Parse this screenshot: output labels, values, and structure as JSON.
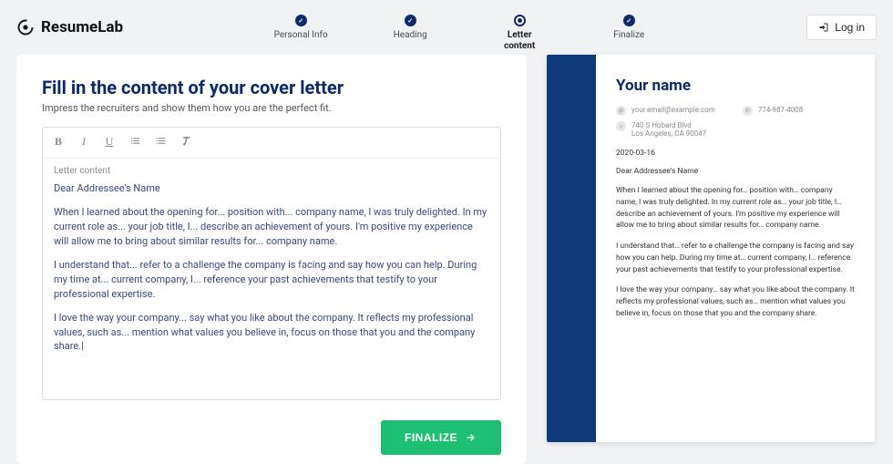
{
  "brand": {
    "name": "ResumeLab"
  },
  "header": {
    "login_label": "Log in"
  },
  "stepper": {
    "steps": [
      {
        "label": "Personal Info",
        "state": "done"
      },
      {
        "label": "Heading",
        "state": "done"
      },
      {
        "label": "Letter content",
        "state": "current"
      },
      {
        "label": "Finalize",
        "state": "done"
      }
    ]
  },
  "editor": {
    "title": "Fill in the content of your cover letter",
    "subtitle": "Impress the recruiters and show them how you are the perfect fit.",
    "field_label": "Letter content",
    "greeting": "Dear Addressee's Name",
    "p1": "When I learned about the opening for... position with... company name, I was truly delighted. In my current role as... your job title, I... describe an achievement of yours. I'm positive my experience will allow me to bring about similar results for... company name.",
    "p2": "I understand that... refer to a challenge the company is facing and say how you can help. During my time at... current company, I... reference your past achievements that testify to your professional expertise.",
    "p3": "I love the way your company... say what you like about the company. It reflects my professional values, such as... mention what values you believe in, focus on those that you and the company share.",
    "button_label": "FINALIZE"
  },
  "preview": {
    "name": "Your name",
    "email": "your.email@example.com",
    "phone": "774-987-4008",
    "addr1": "740 S Hobard Blvd",
    "addr2": "Los Angeles, CA 90047",
    "date": "2020-03-16",
    "greeting": "Dear Addressee's Name",
    "p1": "When I learned about the opening for… position with… company name, I was truly delighted. In my current role as… your job title, I… describe an achievement of yours. I'm positive my experience will allow me to bring about similar results for… company name.",
    "p2": "I understand that… refer to a challenge the company is facing and say how you can help. During my time at… current company, I… reference your past achievements that testify to your professional expertise.",
    "p3": "I love the way your company… say what you like about the company. It reflects my professional values, such as… mention what values you believe in, focus on those that you and the company share."
  }
}
